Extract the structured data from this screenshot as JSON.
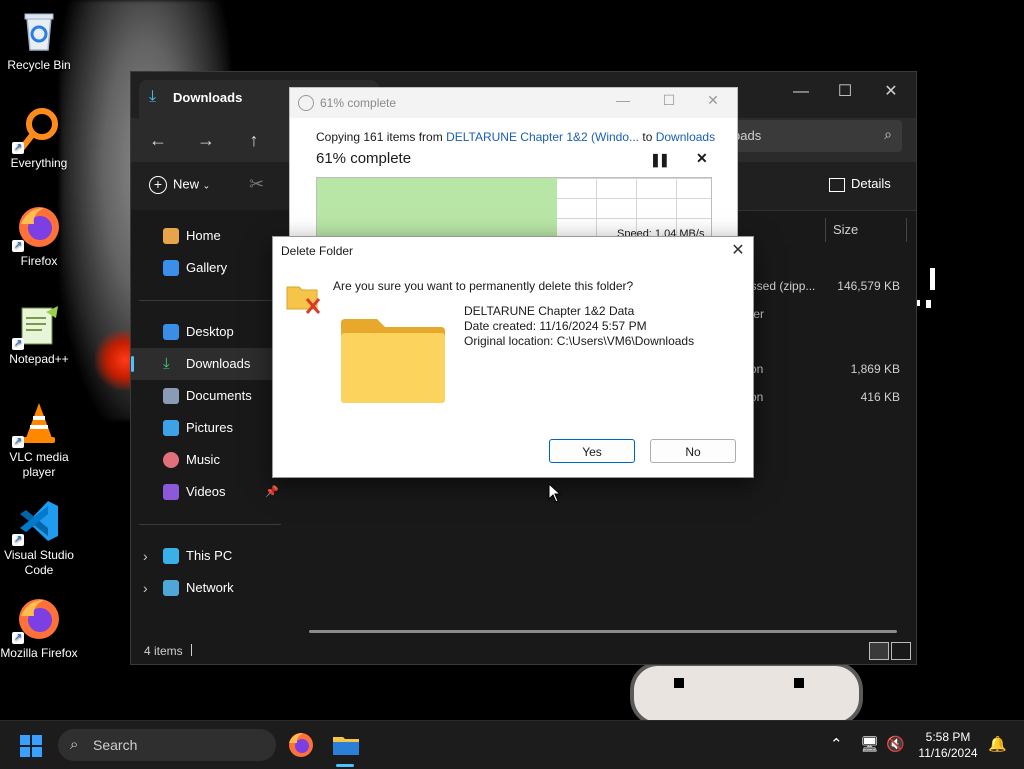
{
  "desktop": {
    "icons": [
      {
        "label": "Recycle Bin",
        "icon": "recycle-bin-icon"
      },
      {
        "label": "Everything",
        "icon": "everything-search-icon"
      },
      {
        "label": "Firefox",
        "icon": "firefox-icon"
      },
      {
        "label": "Notepad++",
        "icon": "notepad-plus-plus-icon"
      },
      {
        "label": "VLC media player",
        "icon": "vlc-icon"
      },
      {
        "label": "Visual Studio Code",
        "icon": "vscode-icon"
      },
      {
        "label": "Mozilla Firefox",
        "icon": "firefox-icon"
      }
    ]
  },
  "explorer": {
    "tab_title": "Downloads",
    "search_placeholder": "oads",
    "new_label": "New",
    "details_label": "Details",
    "sidebar": {
      "home": "Home",
      "gallery": "Gallery",
      "desktop": "Desktop",
      "downloads": "Downloads",
      "documents": "Documents",
      "pictures": "Pictures",
      "music": "Music",
      "videos": "Videos",
      "this_pc": "This PC",
      "network": "Network"
    },
    "columns": {
      "size": "Size"
    },
    "rows": [
      {
        "type": "essed (zipp...",
        "size": "146,579 KB"
      },
      {
        "type": "lder",
        "size": ""
      },
      {
        "type": "tion",
        "size": "1,869 KB"
      },
      {
        "type": "tion",
        "size": "416 KB"
      }
    ],
    "status_count": "4 items"
  },
  "copy_dialog": {
    "title": "61% complete",
    "line_prefix": "Copying 161 items from ",
    "source": "DELTARUNE Chapter 1&2 (Windo...",
    "to_word": " to ",
    "destination": "Downloads",
    "percent_text": "61% complete",
    "speed_text": "Speed: 1.04 MB/s",
    "progress": 0.61
  },
  "delete_dialog": {
    "title": "Delete Folder",
    "question": "Are you sure you want to permanently delete this folder?",
    "folder_name": "DELTARUNE Chapter 1&2 Data",
    "date_created": "Date created: 11/16/2024 5:57 PM",
    "original_location": "Original location: C:\\Users\\VM6\\Downloads",
    "yes_label": "Yes",
    "no_label": "No"
  },
  "taskbar": {
    "search_label": "Search",
    "time": "5:58 PM",
    "date": "11/16/2024"
  },
  "colors": {
    "accent": "#4cc2ff",
    "link": "#1a5fb4",
    "progress_fill": "#b8e6a6",
    "folder": "#f7c44a"
  }
}
